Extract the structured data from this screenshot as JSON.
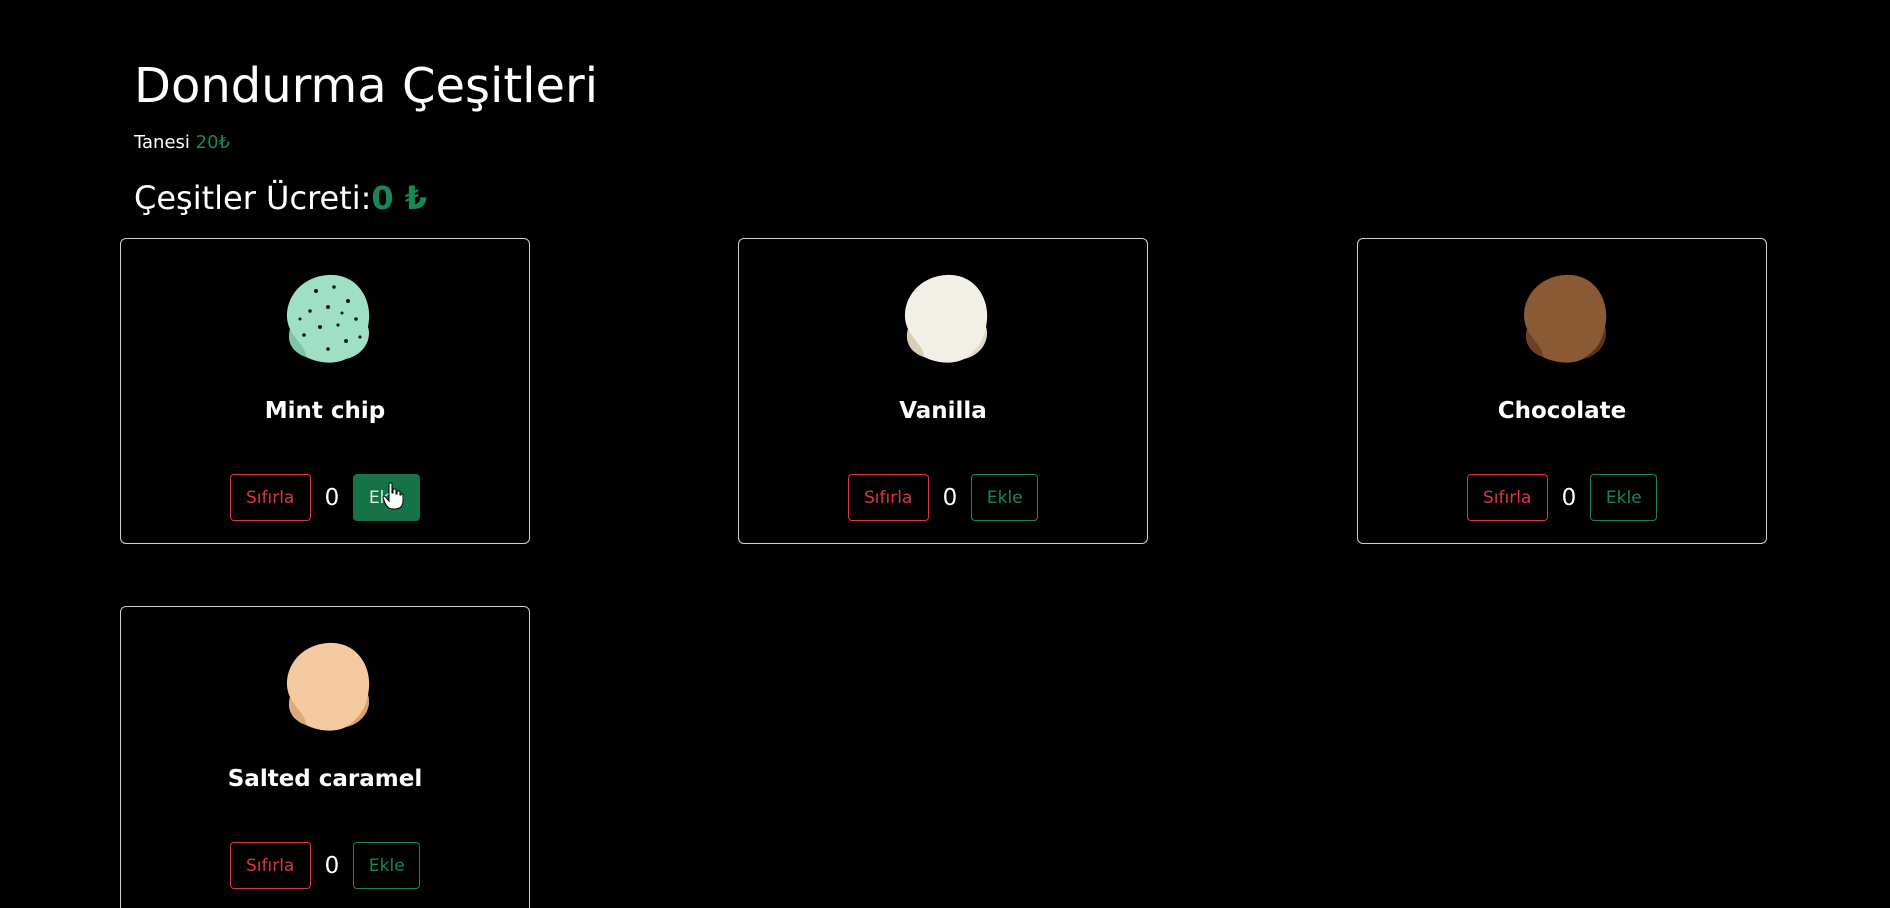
{
  "header": {
    "title": "Dondurma Çeşitleri",
    "unit_label": "Tanesi",
    "unit_price": "20₺",
    "total_label": "Çeşitler Ücreti:",
    "total_value": "0 ₺"
  },
  "colors": {
    "accent_green": "#198754",
    "accent_red": "#dc3545",
    "background": "#000000"
  },
  "flavors": [
    {
      "name": "Mint chip",
      "count": "0",
      "reset_label": "Sıfırla",
      "add_label": "Ekle",
      "scoop_color": "#9fe0c4",
      "icon": "mint-chip-scoop-icon"
    },
    {
      "name": "Vanilla",
      "count": "0",
      "reset_label": "Sıfırla",
      "add_label": "Ekle",
      "scoop_color": "#f2efe6",
      "icon": "vanilla-scoop-icon"
    },
    {
      "name": "Chocolate",
      "count": "0",
      "reset_label": "Sıfırla",
      "add_label": "Ekle",
      "scoop_color": "#8a5a34",
      "icon": "chocolate-scoop-icon"
    },
    {
      "name": "Salted caramel",
      "count": "0",
      "reset_label": "Sıfırla",
      "add_label": "Ekle",
      "scoop_color": "#f5caa0",
      "icon": "salted-caramel-scoop-icon"
    }
  ]
}
